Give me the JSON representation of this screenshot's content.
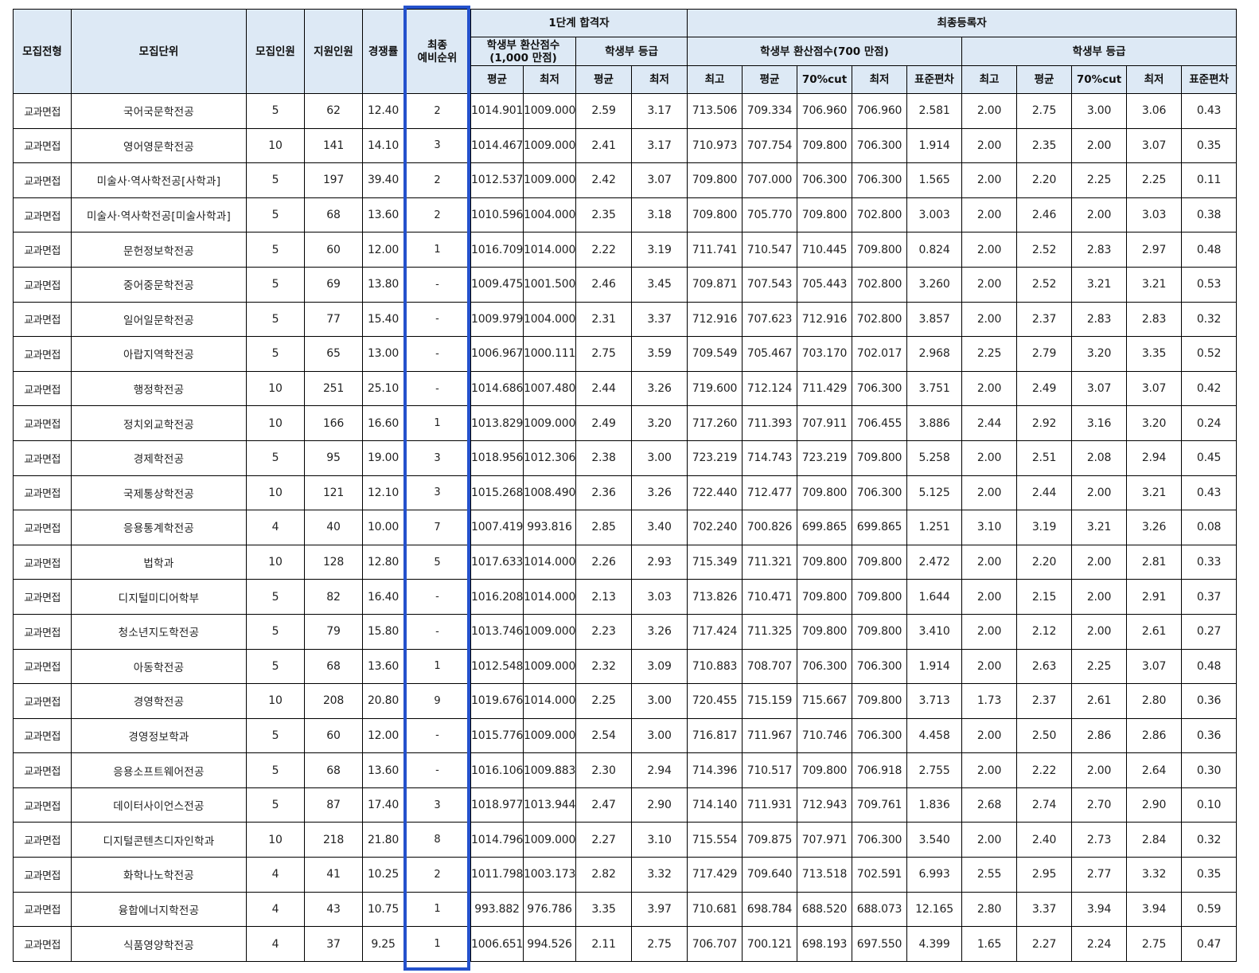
{
  "headers": {
    "type": "모집전형",
    "unit": "모집단위",
    "quota": "모집인원",
    "applicants": "지원인원",
    "ratio": "경쟁률",
    "rank_line1": "최종",
    "rank_line2": "예비순위",
    "stage1": "1단계 합격자",
    "final": "최종등록자",
    "stage1_score": "학생부 환산점수",
    "stage1_score_sub": "(1,000 만점)",
    "stage1_grade": "학생부 등급",
    "final_score": "학생부 환산점수(700 만점)",
    "final_grade": "학생부 등급",
    "avg": "평균",
    "min": "최저",
    "max": "최고",
    "cut70": "70%cut",
    "stdev": "표준편차"
  },
  "rows": [
    [
      "교과면접",
      "국어국문학전공",
      "5",
      "62",
      "12.40",
      "2",
      "1014.901",
      "1009.000",
      "2.59",
      "3.17",
      "713.506",
      "709.334",
      "706.960",
      "706.960",
      "2.581",
      "2.00",
      "2.75",
      "3.00",
      "3.06",
      "0.43"
    ],
    [
      "교과면접",
      "영어영문학전공",
      "10",
      "141",
      "14.10",
      "3",
      "1014.467",
      "1009.000",
      "2.41",
      "3.17",
      "710.973",
      "707.754",
      "709.800",
      "706.300",
      "1.914",
      "2.00",
      "2.35",
      "2.00",
      "3.07",
      "0.35"
    ],
    [
      "교과면접",
      "미술사·역사학전공[사학과]",
      "5",
      "197",
      "39.40",
      "2",
      "1012.537",
      "1009.000",
      "2.42",
      "3.07",
      "709.800",
      "707.000",
      "706.300",
      "706.300",
      "1.565",
      "2.00",
      "2.20",
      "2.25",
      "2.25",
      "0.11"
    ],
    [
      "교과면접",
      "미술사·역사학전공[미술사학과]",
      "5",
      "68",
      "13.60",
      "2",
      "1010.596",
      "1004.000",
      "2.35",
      "3.18",
      "709.800",
      "705.770",
      "709.800",
      "702.800",
      "3.003",
      "2.00",
      "2.46",
      "2.00",
      "3.03",
      "0.38"
    ],
    [
      "교과면접",
      "문헌정보학전공",
      "5",
      "60",
      "12.00",
      "1",
      "1016.709",
      "1014.000",
      "2.22",
      "3.19",
      "711.741",
      "710.547",
      "710.445",
      "709.800",
      "0.824",
      "2.00",
      "2.52",
      "2.83",
      "2.97",
      "0.48"
    ],
    [
      "교과면접",
      "중어중문학전공",
      "5",
      "69",
      "13.80",
      "-",
      "1009.475",
      "1001.500",
      "2.46",
      "3.45",
      "709.871",
      "707.543",
      "705.443",
      "702.800",
      "3.260",
      "2.00",
      "2.52",
      "3.21",
      "3.21",
      "0.53"
    ],
    [
      "교과면접",
      "일어일문학전공",
      "5",
      "77",
      "15.40",
      "-",
      "1009.979",
      "1004.000",
      "2.31",
      "3.37",
      "712.916",
      "707.623",
      "712.916",
      "702.800",
      "3.857",
      "2.00",
      "2.37",
      "2.83",
      "2.83",
      "0.32"
    ],
    [
      "교과면접",
      "아랍지역학전공",
      "5",
      "65",
      "13.00",
      "-",
      "1006.967",
      "1000.111",
      "2.75",
      "3.59",
      "709.549",
      "705.467",
      "703.170",
      "702.017",
      "2.968",
      "2.25",
      "2.79",
      "3.20",
      "3.35",
      "0.52"
    ],
    [
      "교과면접",
      "행정학전공",
      "10",
      "251",
      "25.10",
      "-",
      "1014.686",
      "1007.480",
      "2.44",
      "3.26",
      "719.600",
      "712.124",
      "711.429",
      "706.300",
      "3.751",
      "2.00",
      "2.49",
      "3.07",
      "3.07",
      "0.42"
    ],
    [
      "교과면접",
      "정치외교학전공",
      "10",
      "166",
      "16.60",
      "1",
      "1013.829",
      "1009.000",
      "2.49",
      "3.20",
      "717.260",
      "711.393",
      "707.911",
      "706.455",
      "3.886",
      "2.44",
      "2.92",
      "3.16",
      "3.20",
      "0.24"
    ],
    [
      "교과면접",
      "경제학전공",
      "5",
      "95",
      "19.00",
      "3",
      "1018.956",
      "1012.306",
      "2.38",
      "3.00",
      "723.219",
      "714.743",
      "723.219",
      "709.800",
      "5.258",
      "2.00",
      "2.51",
      "2.08",
      "2.94",
      "0.45"
    ],
    [
      "교과면접",
      "국제통상학전공",
      "10",
      "121",
      "12.10",
      "3",
      "1015.268",
      "1008.490",
      "2.36",
      "3.26",
      "722.440",
      "712.477",
      "709.800",
      "706.300",
      "5.125",
      "2.00",
      "2.44",
      "2.00",
      "3.21",
      "0.43"
    ],
    [
      "교과면접",
      "응용통계학전공",
      "4",
      "40",
      "10.00",
      "7",
      "1007.419",
      "993.816",
      "2.85",
      "3.40",
      "702.240",
      "700.826",
      "699.865",
      "699.865",
      "1.251",
      "3.10",
      "3.19",
      "3.21",
      "3.26",
      "0.08"
    ],
    [
      "교과면접",
      "법학과",
      "10",
      "128",
      "12.80",
      "5",
      "1017.633",
      "1014.000",
      "2.26",
      "2.93",
      "715.349",
      "711.321",
      "709.800",
      "709.800",
      "2.472",
      "2.00",
      "2.20",
      "2.00",
      "2.81",
      "0.33"
    ],
    [
      "교과면접",
      "디지털미디어학부",
      "5",
      "82",
      "16.40",
      "-",
      "1016.208",
      "1014.000",
      "2.13",
      "3.03",
      "713.826",
      "710.471",
      "709.800",
      "709.800",
      "1.644",
      "2.00",
      "2.15",
      "2.00",
      "2.91",
      "0.37"
    ],
    [
      "교과면접",
      "청소년지도학전공",
      "5",
      "79",
      "15.80",
      "-",
      "1013.746",
      "1009.000",
      "2.23",
      "3.26",
      "717.424",
      "711.325",
      "709.800",
      "709.800",
      "3.410",
      "2.00",
      "2.12",
      "2.00",
      "2.61",
      "0.27"
    ],
    [
      "교과면접",
      "아동학전공",
      "5",
      "68",
      "13.60",
      "1",
      "1012.548",
      "1009.000",
      "2.32",
      "3.09",
      "710.883",
      "708.707",
      "706.300",
      "706.300",
      "1.914",
      "2.00",
      "2.63",
      "2.25",
      "3.07",
      "0.48"
    ],
    [
      "교과면접",
      "경영학전공",
      "10",
      "208",
      "20.80",
      "9",
      "1019.676",
      "1014.000",
      "2.25",
      "3.00",
      "720.455",
      "715.159",
      "715.667",
      "709.800",
      "3.713",
      "1.73",
      "2.37",
      "2.61",
      "2.80",
      "0.36"
    ],
    [
      "교과면접",
      "경영정보학과",
      "5",
      "60",
      "12.00",
      "-",
      "1015.776",
      "1009.000",
      "2.54",
      "3.00",
      "716.817",
      "711.967",
      "710.746",
      "706.300",
      "4.458",
      "2.00",
      "2.50",
      "2.86",
      "2.86",
      "0.36"
    ],
    [
      "교과면접",
      "응용소프트웨어전공",
      "5",
      "68",
      "13.60",
      "-",
      "1016.106",
      "1009.883",
      "2.30",
      "2.94",
      "714.396",
      "710.517",
      "709.800",
      "706.918",
      "2.755",
      "2.00",
      "2.22",
      "2.00",
      "2.64",
      "0.30"
    ],
    [
      "교과면접",
      "데이터사이언스전공",
      "5",
      "87",
      "17.40",
      "3",
      "1018.977",
      "1013.944",
      "2.47",
      "2.90",
      "714.140",
      "711.931",
      "712.943",
      "709.761",
      "1.836",
      "2.68",
      "2.74",
      "2.70",
      "2.90",
      "0.10"
    ],
    [
      "교과면접",
      "디지털콘텐츠디자인학과",
      "10",
      "218",
      "21.80",
      "8",
      "1014.796",
      "1009.000",
      "2.27",
      "3.10",
      "715.554",
      "709.875",
      "707.971",
      "706.300",
      "3.540",
      "2.00",
      "2.40",
      "2.73",
      "2.84",
      "0.32"
    ],
    [
      "교과면접",
      "화학나노학전공",
      "4",
      "41",
      "10.25",
      "2",
      "1011.798",
      "1003.173",
      "2.82",
      "3.32",
      "717.429",
      "709.640",
      "713.518",
      "702.591",
      "6.993",
      "2.55",
      "2.95",
      "2.77",
      "3.32",
      "0.35"
    ],
    [
      "교과면접",
      "융합에너지학전공",
      "4",
      "43",
      "10.75",
      "1",
      "993.882",
      "976.786",
      "3.35",
      "3.97",
      "710.681",
      "698.784",
      "688.520",
      "688.073",
      "12.165",
      "2.80",
      "3.37",
      "3.94",
      "3.94",
      "0.59"
    ],
    [
      "교과면접",
      "식품영양학전공",
      "4",
      "37",
      "9.25",
      "1",
      "1006.651",
      "994.526",
      "2.11",
      "2.75",
      "706.707",
      "700.121",
      "698.193",
      "697.550",
      "4.399",
      "1.65",
      "2.27",
      "2.24",
      "2.75",
      "0.47"
    ]
  ]
}
